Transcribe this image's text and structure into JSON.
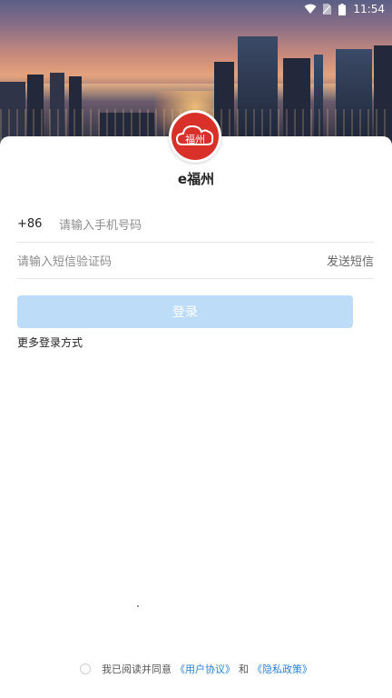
{
  "status_bar": {
    "time": "11:54"
  },
  "app": {
    "name": "e福州",
    "logo_text": "福州"
  },
  "login": {
    "country_code": "+86",
    "phone_placeholder": "请输入手机号码",
    "code_placeholder": "请输入短信验证码",
    "send_code_label": "发送短信",
    "login_button": "登录",
    "more_login_methods": "更多登录方式"
  },
  "agreement": {
    "prefix": "我已阅读并同意",
    "user_agreement": "《用户协议》",
    "and": "和",
    "privacy_policy": "《隐私政策》"
  },
  "colors": {
    "logo_red": "#d9302a",
    "button_disabled": "#bcdcf8",
    "link": "#2a7fd4"
  }
}
